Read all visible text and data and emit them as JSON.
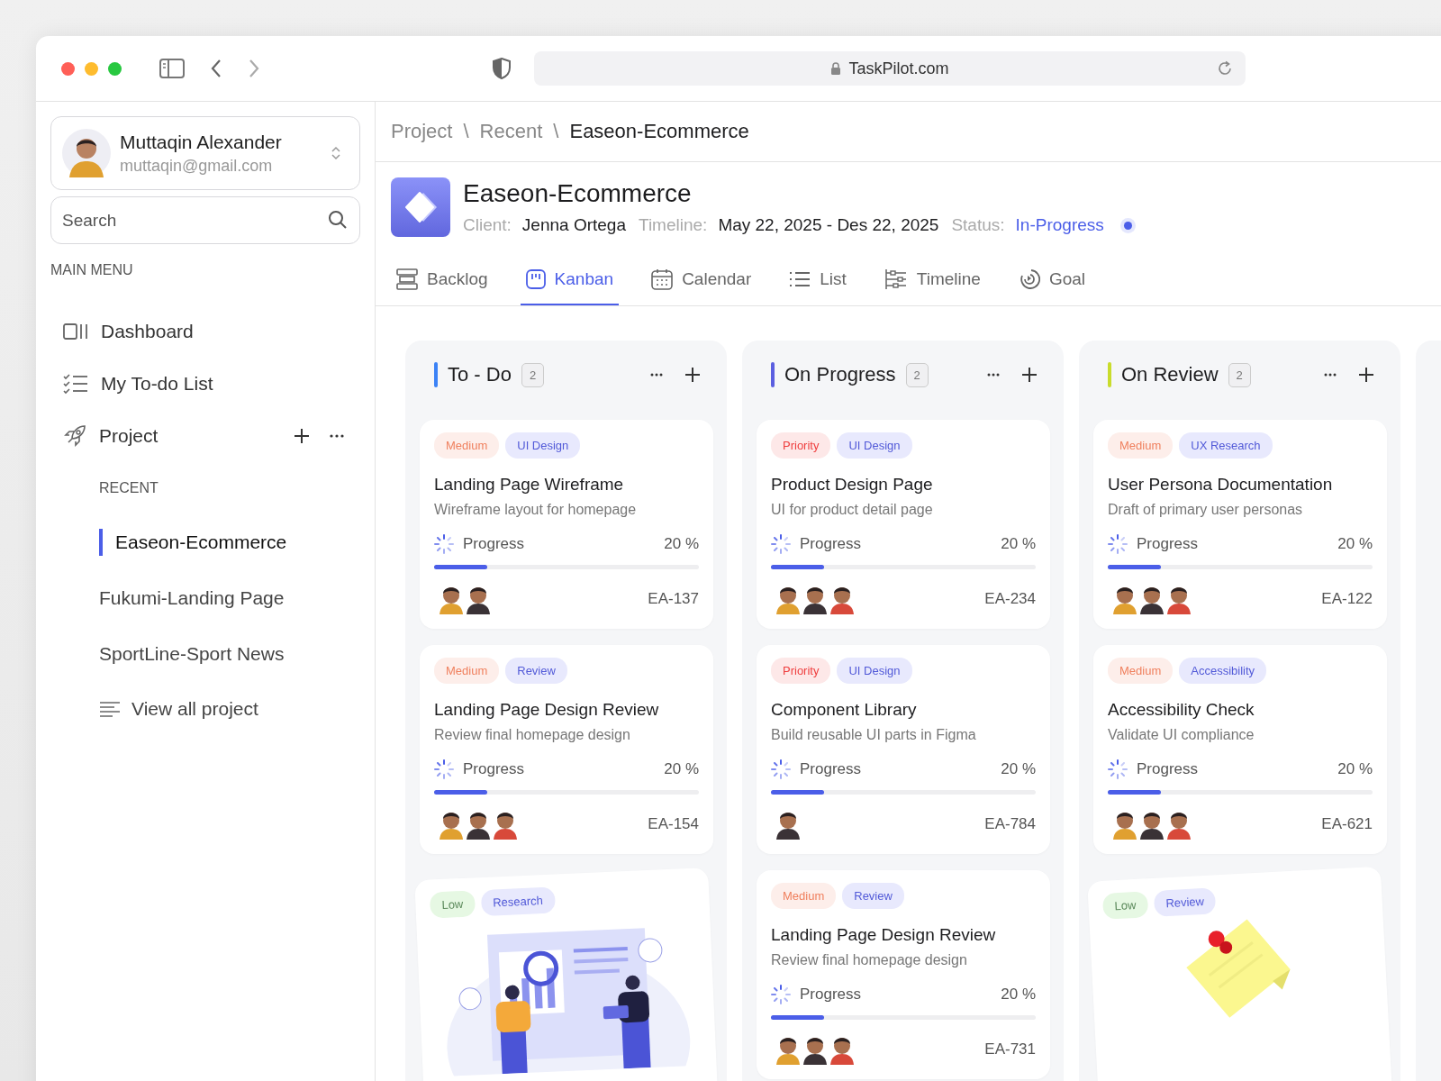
{
  "browser": {
    "url": "TaskPilot.com"
  },
  "user": {
    "name": "Muttaqin Alexander",
    "email": "muttaqin@gmail.com"
  },
  "search": {
    "placeholder": "Search"
  },
  "sidebar": {
    "section": "MAIN MENU",
    "items": [
      {
        "label": "Dashboard",
        "kind": "dashboard"
      },
      {
        "label": "My To-do List",
        "kind": "todo"
      }
    ],
    "project": {
      "label": "Project"
    },
    "recent_label": "RECENT",
    "recent": [
      {
        "label": "Easeon-Ecommerce",
        "selected": true
      },
      {
        "label": "Fukumi-Landing Page",
        "selected": false
      },
      {
        "label": "SportLine-Sport News",
        "selected": false
      }
    ],
    "view_all": "View all project"
  },
  "breadcrumb": {
    "items": [
      "Project",
      "Recent",
      "Easeon-Ecommerce"
    ],
    "separators": [
      "\\",
      "\\"
    ]
  },
  "project": {
    "title": "Easeon-Ecommerce",
    "fields": [
      {
        "label": "Client:",
        "value": "Jenna Ortega",
        "kind": "text"
      },
      {
        "label": "Timeline:",
        "value": "May 22, 2025 - Des 22, 2025",
        "kind": "text"
      },
      {
        "label": "Status:",
        "value": "In-Progress",
        "kind": "status"
      }
    ]
  },
  "tabs": [
    {
      "label": "Backlog",
      "selected": false
    },
    {
      "label": "Kanban",
      "selected": true
    },
    {
      "label": "Calendar",
      "selected": false
    },
    {
      "label": "List",
      "selected": false
    },
    {
      "label": "Timeline",
      "selected": false
    },
    {
      "label": "Goal",
      "selected": false
    }
  ],
  "columns": [
    {
      "title": "To - Do",
      "color": "#3b82f6",
      "count": "2",
      "cards": [
        {
          "kind": "task",
          "tags": [
            {
              "label": "Medium",
              "kind": "medium"
            },
            {
              "label": "UI Design",
              "kind": "category"
            }
          ],
          "title": "Landing Page Wireframe",
          "subtitle": "Wireframe layout for homepage",
          "progress_label": "Progress",
          "reading": "20 %",
          "level": 0.2,
          "assignees": [
            {
              "color": "#e0a030"
            },
            {
              "color": "#3a3236"
            }
          ],
          "id": "EA-137"
        },
        {
          "kind": "task",
          "tags": [
            {
              "label": "Medium",
              "kind": "medium"
            },
            {
              "label": "Review",
              "kind": "category"
            }
          ],
          "title": "Landing Page Design Review",
          "subtitle": "Review final homepage design",
          "progress_label": "Progress",
          "reading": "20 %",
          "level": 0.2,
          "assignees": [
            {
              "color": "#e0a030"
            },
            {
              "color": "#3a3236"
            },
            {
              "color": "#d8493a"
            }
          ],
          "id": "EA-154"
        },
        {
          "kind": "illustration",
          "tags": [
            {
              "label": "Low",
              "kind": "low"
            },
            {
              "label": "Research",
              "kind": "category"
            }
          ]
        }
      ]
    },
    {
      "title": "On Progress",
      "color": "#5b5fe0",
      "count": "2",
      "cards": [
        {
          "kind": "task",
          "tags": [
            {
              "label": "Priority",
              "kind": "high"
            },
            {
              "label": "UI Design",
              "kind": "category"
            }
          ],
          "title": "Product Design Page",
          "subtitle": "UI for product detail page",
          "progress_label": "Progress",
          "reading": "20 %",
          "level": 0.2,
          "assignees": [
            {
              "color": "#e0a030"
            },
            {
              "color": "#3a3236"
            },
            {
              "color": "#d8493a"
            }
          ],
          "id": "EA-234"
        },
        {
          "kind": "task",
          "tags": [
            {
              "label": "Priority",
              "kind": "high"
            },
            {
              "label": "UI Design",
              "kind": "category"
            }
          ],
          "title": "Component Library",
          "subtitle": "Build reusable UI parts in Figma",
          "progress_label": "Progress",
          "reading": "20 %",
          "level": 0.2,
          "assignees": [
            {
              "color": "#3a3236"
            }
          ],
          "id": "EA-784"
        },
        {
          "kind": "task",
          "tags": [
            {
              "label": "Medium",
              "kind": "medium"
            },
            {
              "label": "Review",
              "kind": "category"
            }
          ],
          "title": "Landing Page Design Review",
          "subtitle": "Review final homepage design",
          "progress_label": "Progress",
          "reading": "20 %",
          "level": 0.2,
          "assignees": [
            {
              "color": "#e0a030"
            },
            {
              "color": "#3a3236"
            },
            {
              "color": "#d8493a"
            }
          ],
          "id": "EA-731"
        }
      ]
    },
    {
      "title": "On Review",
      "color": "#c9dc2c",
      "count": "2",
      "cards": [
        {
          "kind": "task",
          "tags": [
            {
              "label": "Medium",
              "kind": "medium"
            },
            {
              "label": "UX Research",
              "kind": "category"
            }
          ],
          "title": "User Persona Documentation",
          "subtitle": "Draft of primary user personas",
          "progress_label": "Progress",
          "reading": "20 %",
          "level": 0.2,
          "assignees": [
            {
              "color": "#e0a030"
            },
            {
              "color": "#3a3236"
            },
            {
              "color": "#d8493a"
            }
          ],
          "id": "EA-122"
        },
        {
          "kind": "task",
          "tags": [
            {
              "label": "Medium",
              "kind": "medium"
            },
            {
              "label": "Accessibility",
              "kind": "category"
            }
          ],
          "title": "Accessibility Check",
          "subtitle": "Validate UI compliance",
          "progress_label": "Progress",
          "reading": "20 %",
          "level": 0.2,
          "assignees": [
            {
              "color": "#e0a030"
            },
            {
              "color": "#3a3236"
            },
            {
              "color": "#d8493a"
            }
          ],
          "id": "EA-621"
        },
        {
          "kind": "note",
          "tags": [
            {
              "label": "Low",
              "kind": "low"
            },
            {
              "label": "Review",
              "kind": "category"
            }
          ]
        }
      ]
    }
  ]
}
